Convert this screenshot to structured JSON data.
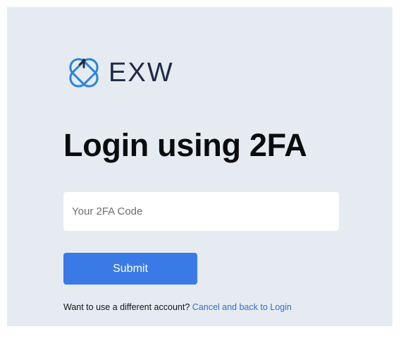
{
  "brand": {
    "name": "EXW",
    "colors": {
      "logo_blue": "#2f86d6",
      "logo_dark": "#1f2a44"
    },
    "icon": "exw-logo-icon"
  },
  "page": {
    "title": "Login using 2FA"
  },
  "form": {
    "code_value": "",
    "code_placeholder": "Your 2FA Code",
    "submit_label": "Submit"
  },
  "footer": {
    "prompt": "Want to use a different account?",
    "link_label": "Cancel and back to Login"
  },
  "colors": {
    "panel_bg": "#e6ebf2",
    "button_bg": "#3a7ae6",
    "link": "#2f6fcf"
  }
}
